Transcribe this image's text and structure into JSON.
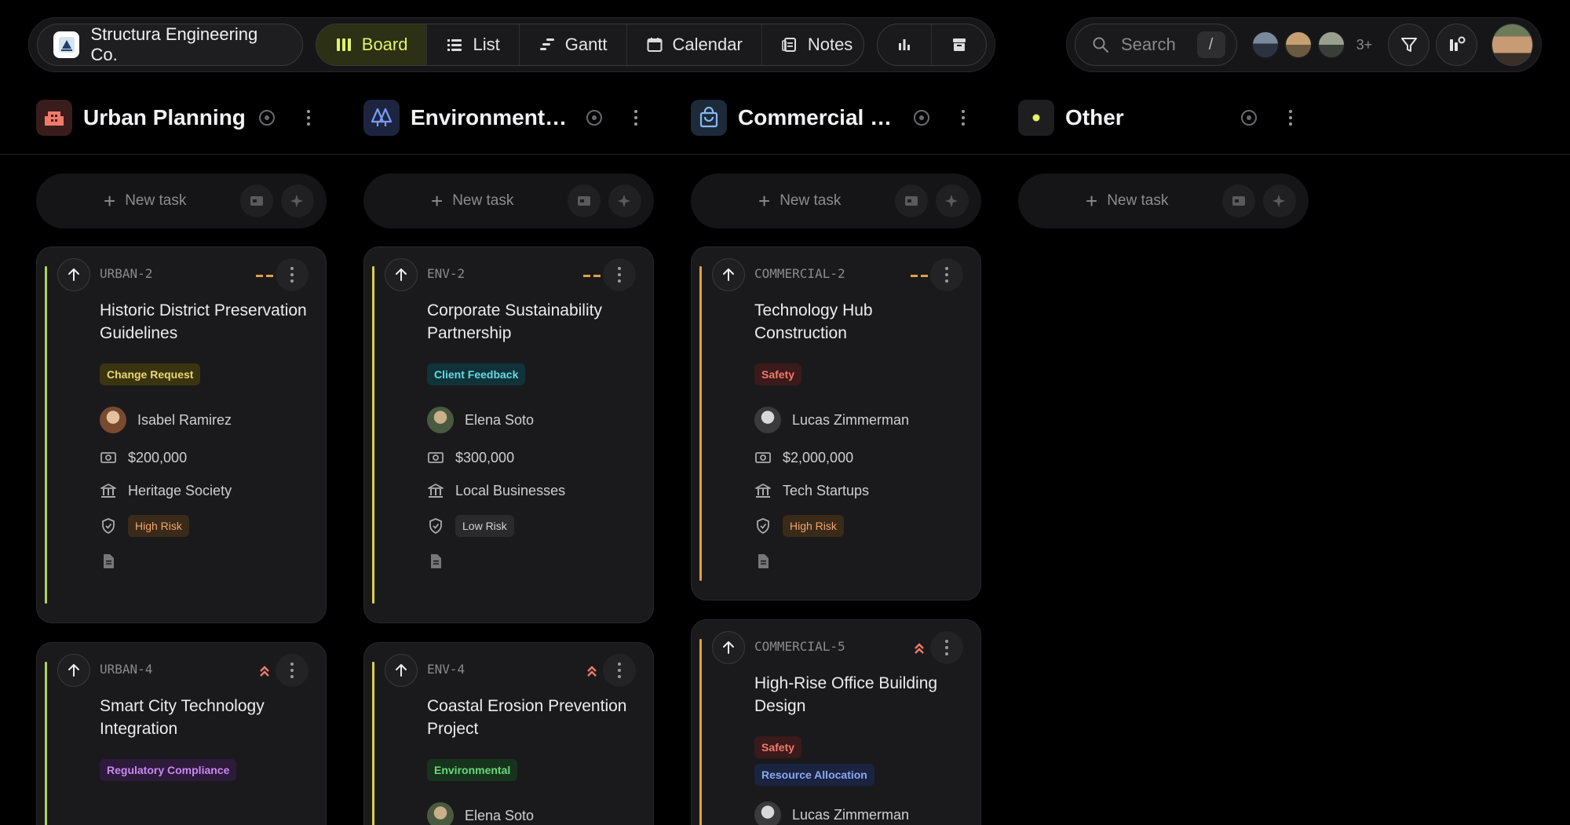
{
  "workspace": {
    "name": "Structura Engineering Co."
  },
  "views": [
    {
      "label": "Board",
      "icon": "board-icon",
      "active": true
    },
    {
      "label": "List",
      "icon": "list-icon",
      "active": false
    },
    {
      "label": "Gantt",
      "icon": "gantt-icon",
      "active": false
    },
    {
      "label": "Calendar",
      "icon": "calendar-icon",
      "active": false
    },
    {
      "label": "Notes",
      "icon": "notes-icon",
      "active": false
    }
  ],
  "search": {
    "placeholder": "Search",
    "shortcut": "/"
  },
  "members": {
    "more": "3+"
  },
  "new_task_label": "New task",
  "colors": {
    "accent_green": "#a9d65a",
    "accent_yellow": "#d9d24a",
    "accent_orange": "#e0a040",
    "active_view": "#e3f26a"
  },
  "columns": [
    {
      "title": "Urban Planning",
      "icon": "building-icon",
      "icon_bg": "#3a1c1c",
      "icon_color": "#f07a6a"
    },
    {
      "title": "Environmenta...",
      "icon": "trees-icon",
      "icon_bg": "#1c2440",
      "icon_color": "#7a9af0"
    },
    {
      "title": "Commercial D...",
      "icon": "shopping-bag-icon",
      "icon_bg": "#1c2a3a",
      "icon_color": "#8ab8f0"
    },
    {
      "title": "Other",
      "icon": "dot-icon",
      "icon_bg": "#1e1e20",
      "icon_color": "#e3f26a"
    }
  ],
  "cards": {
    "urban_2": {
      "id": "URBAN-2",
      "priority": "medium",
      "title": "Historic District Preservation Guidelines",
      "tags": [
        "Change Request"
      ],
      "assignee": "Isabel Ramirez",
      "budget": "$200,000",
      "client": "Heritage Society",
      "risk": "High Risk"
    },
    "env_2": {
      "id": "ENV-2",
      "priority": "medium",
      "title": "Corporate Sustainability Partnership",
      "tags": [
        "Client Feedback"
      ],
      "assignee": "Elena Soto",
      "budget": "$300,000",
      "client": "Local Businesses",
      "risk": "Low Risk"
    },
    "com_2": {
      "id": "COMMERCIAL-2",
      "priority": "medium",
      "title": "Technology Hub Construction",
      "tags": [
        "Safety"
      ],
      "assignee": "Lucas Zimmerman",
      "budget": "$2,000,000",
      "client": "Tech Startups",
      "risk": "High Risk"
    },
    "urban_4": {
      "id": "URBAN-4",
      "priority": "urgent",
      "title": "Smart City Technology Integration",
      "tags": [
        "Regulatory Compliance"
      ]
    },
    "env_4": {
      "id": "ENV-4",
      "priority": "urgent",
      "title": "Coastal Erosion Prevention Project",
      "tags": [
        "Environmental"
      ],
      "assignee": "Elena Soto"
    },
    "com_5": {
      "id": "COMMERCIAL-5",
      "priority": "urgent",
      "title": "High-Rise Office Building Design",
      "tags": [
        "Safety",
        "Resource Allocation"
      ],
      "assignee": "Lucas Zimmerman"
    }
  }
}
